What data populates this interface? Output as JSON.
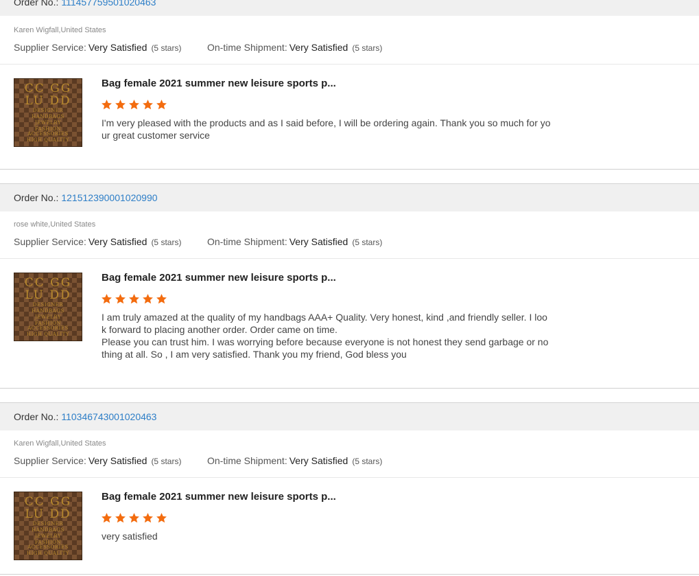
{
  "order_label": "Order No.:",
  "supplier_label": "Supplier Service:",
  "shipment_label": "On-time Shipment:",
  "colors": {
    "link": "#2d7ec7",
    "star": "#f36c0f",
    "bar": "#f0f0f0"
  },
  "reviews": [
    {
      "order_no": "111457759501020463",
      "buyer": "Karen Wigfall,United States",
      "supplier_value": "Very Satisfied",
      "supplier_stars": "(5 stars)",
      "shipment_value": "Very Satisfied",
      "shipment_stars": "(5 stars)",
      "product_title": "Bag female 2021 summer new leisure sports p...",
      "rating": 5,
      "text": "I'm very pleased with the products and as I said before, I will be ordering again. Thank you so much for your great customer service"
    },
    {
      "order_no": "121512390001020990",
      "buyer": "rose white,United States",
      "supplier_value": "Very Satisfied",
      "supplier_stars": "(5 stars)",
      "shipment_value": "Very Satisfied",
      "shipment_stars": "(5 stars)",
      "product_title": "Bag female 2021 summer new leisure sports p...",
      "rating": 5,
      "text": "I am truly amazed at the quality of my handbags AAA+  Quality.  Very honest, kind ,and friendly seller. I look forward to placing another order. Order came on time.\nPlease you can trust him. I was worrying before because everyone is not honest they send garbage or nothing at all. So , I am very satisfied.   Thank you my friend, God bless you"
    },
    {
      "order_no": "110346743001020463",
      "buyer": "Karen Wigfall,United States",
      "supplier_value": "Very Satisfied",
      "supplier_stars": "(5 stars)",
      "shipment_value": "Very Satisfied",
      "shipment_stars": "(5 stars)",
      "product_title": "Bag female 2021 summer new leisure sports p...",
      "rating": 5,
      "text": "very satisfied"
    }
  ],
  "thumb_logo": {
    "line1": "CC GG",
    "line2": "LU DD",
    "line3": "DESIGNER",
    "line4": "HANDBAGS",
    "line5": "JEWELRY",
    "line6": "FASHION ACCESSORIES",
    "line7": "HIGH QUALITY"
  }
}
